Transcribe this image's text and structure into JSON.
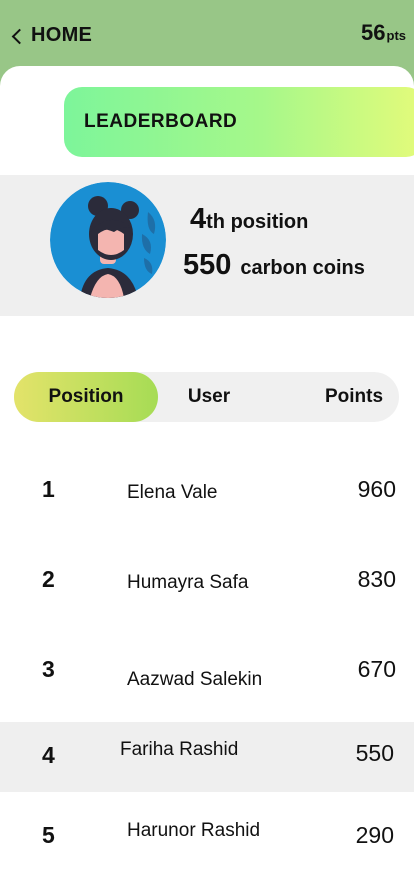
{
  "header": {
    "back_label": "HOME",
    "points_value": "56",
    "points_unit": "pts"
  },
  "banner": {
    "title": "LEADERBOARD"
  },
  "profile": {
    "position_number": "4",
    "position_suffix": "th position",
    "coins_value": "550",
    "coins_label": "carbon coins"
  },
  "tabs": {
    "position": "Position",
    "user": "User",
    "points": "Points"
  },
  "leaderboard": [
    {
      "rank": "1",
      "name": "Elena Vale",
      "points": "960"
    },
    {
      "rank": "2",
      "name": "Humayra Safa",
      "points": "830"
    },
    {
      "rank": "3",
      "name": "Aazwad Salekin",
      "points": "670"
    },
    {
      "rank": "4",
      "name": "Fariha Rashid",
      "points": "550"
    },
    {
      "rank": "5",
      "name": "Harunor Rashid",
      "points": "290"
    }
  ],
  "colors": {
    "header_bg": "#98c687",
    "banner_gradient_start": "#7df59a",
    "banner_gradient_end": "#e4fb7a",
    "active_tab_start": "#e3e36a",
    "active_tab_end": "#a6dc55",
    "highlight_row_bg": "#efefef"
  }
}
